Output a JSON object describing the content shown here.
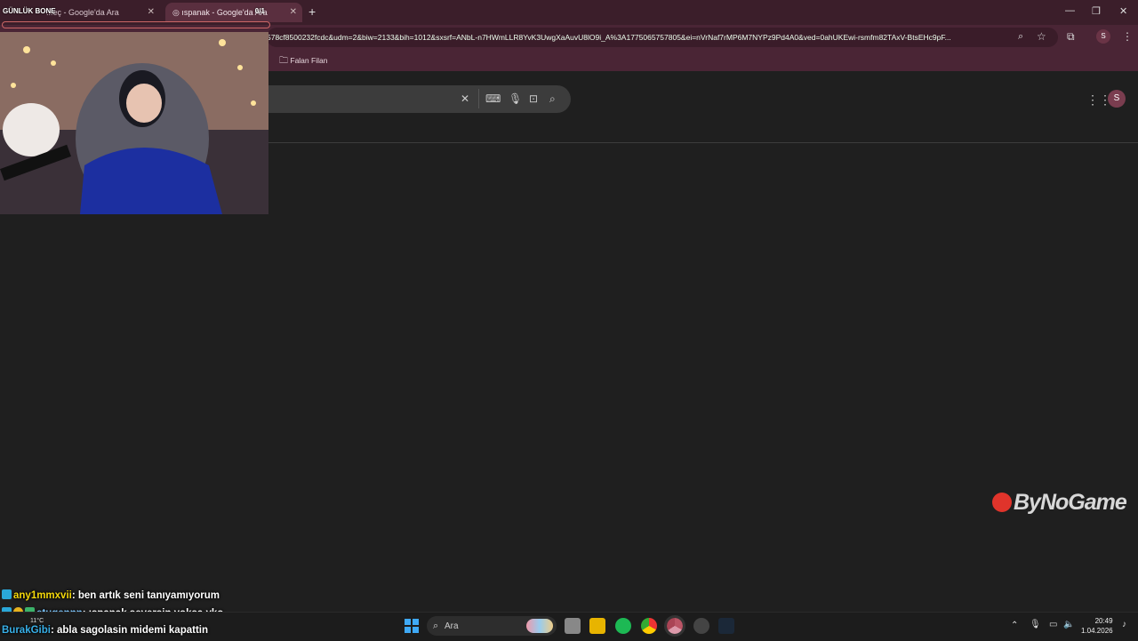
{
  "browser": {
    "tabs": [
      {
        "label": "...eç - Google'da Ara",
        "active": false
      },
      {
        "label": "ıspanak - Google'da Ara",
        "active": true
      }
    ],
    "new_tab": "+",
    "window_controls": {
      "minimize": "—",
      "restore": "❐",
      "close": "✕"
    },
    "address": "578cf8500232fcdc&udm=2&biw=2133&bih=1012&sxsrf=ANbL-n7HWmLLR8YvK3UwgXaAuvU8lO9i_A%3A1775065757805&ei=nVrNaf7rMP6M7NYPz9Pd4A0&ved=0ahUKEwi-rsmfm82TAxV-BtsEHc9pF...",
    "profile_initial": "S",
    "bookmark_folder": "Falan Filan"
  },
  "google": {
    "account_initial": "S"
  },
  "overlay": {
    "badge": "GÜNLÜK BONE",
    "badge_count": "0/1",
    "logo": "ByNoGame"
  },
  "chat": [
    {
      "user": "any1mmxvii",
      "message": ": ben artık seni tanıyamıyorum",
      "color": "#f5d90a"
    },
    {
      "user": "etugennn",
      "message": ": ıspanak seversin yoksa yko",
      "color": "#7fc8ff"
    },
    {
      "user": "BurakGibi",
      "message": ": abla sagolasin midemi kapattin",
      "color": "#38b0e8"
    }
  ],
  "taskbar": {
    "search_label": "Ara",
    "weather": "11°C",
    "time": "20:49",
    "date": "1.04.2026"
  }
}
